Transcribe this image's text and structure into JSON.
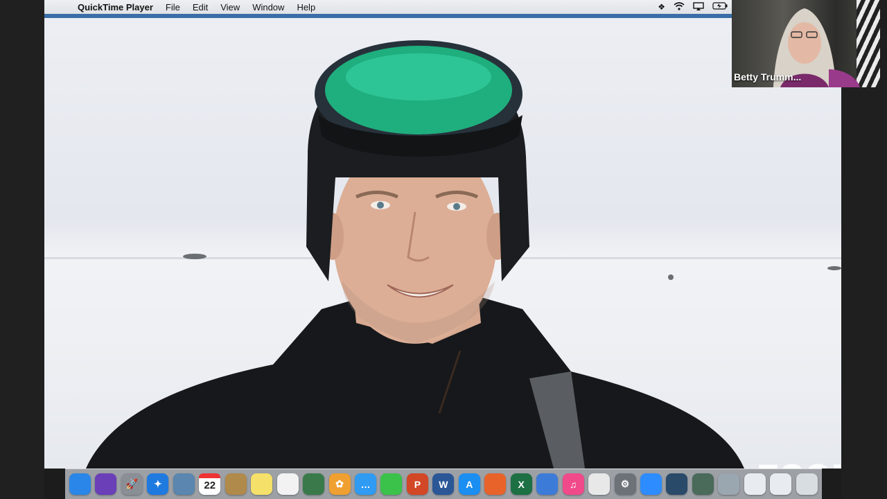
{
  "menubar": {
    "app_name": "QuickTime Player",
    "menus": [
      "File",
      "Edit",
      "View",
      "Window",
      "Help"
    ]
  },
  "thumbnail": {
    "participant_name": "Betty Trumm..."
  },
  "watermark": "zoom",
  "dock": {
    "calendar_day": "22",
    "icons": [
      {
        "name": "finder-icon",
        "color": "#2a86e8",
        "glyph": ""
      },
      {
        "name": "siri-icon",
        "color": "#6a3fb8",
        "glyph": ""
      },
      {
        "name": "launchpad-icon",
        "color": "#8a8f96",
        "glyph": "🚀"
      },
      {
        "name": "safari-icon",
        "color": "#1f7ae0",
        "glyph": "✦"
      },
      {
        "name": "preview-icon",
        "color": "#5a86b0",
        "glyph": ""
      },
      {
        "name": "calendar-icon",
        "color": "#ffffff",
        "glyph": ""
      },
      {
        "name": "contacts-icon",
        "color": "#b08a4a",
        "glyph": ""
      },
      {
        "name": "notes-icon",
        "color": "#f5e06a",
        "glyph": ""
      },
      {
        "name": "reminders-icon",
        "color": "#f2f2f2",
        "glyph": ""
      },
      {
        "name": "photo-booth-icon",
        "color": "#3a7a4a",
        "glyph": ""
      },
      {
        "name": "photos-icon",
        "color": "#f0a030",
        "glyph": "✿"
      },
      {
        "name": "messages-icon",
        "color": "#2f9bf2",
        "glyph": "…"
      },
      {
        "name": "facetime-icon",
        "color": "#3bc24a",
        "glyph": ""
      },
      {
        "name": "powerpoint-icon",
        "color": "#d24726",
        "glyph": "P"
      },
      {
        "name": "word-icon",
        "color": "#2b5797",
        "glyph": "W"
      },
      {
        "name": "app-store-icon",
        "color": "#1b8ef2",
        "glyph": "A"
      },
      {
        "name": "firefox-icon",
        "color": "#e8632a",
        "glyph": ""
      },
      {
        "name": "excel-icon",
        "color": "#1d7044",
        "glyph": "X"
      },
      {
        "name": "keynote-icon",
        "color": "#3d7bd9",
        "glyph": ""
      },
      {
        "name": "itunes-icon",
        "color": "#f04a8a",
        "glyph": "♫"
      },
      {
        "name": "chrome-icon",
        "color": "#e8e8e8",
        "glyph": ""
      },
      {
        "name": "system-preferences-icon",
        "color": "#6d7278",
        "glyph": "⚙"
      },
      {
        "name": "zoom-icon",
        "color": "#2d8cff",
        "glyph": ""
      },
      {
        "name": "quicktime-icon",
        "color": "#2a4a6a",
        "glyph": ""
      },
      {
        "name": "screen-utility-icon",
        "color": "#4a6a5a",
        "glyph": ""
      },
      {
        "name": "screenshot-icon",
        "color": "#9aa6b0",
        "glyph": ""
      },
      {
        "name": "file-stack-icon",
        "color": "#e8ecf0",
        "glyph": ""
      },
      {
        "name": "file-stack-icon-2",
        "color": "#e8ecf0",
        "glyph": ""
      },
      {
        "name": "trash-icon",
        "color": "#d8dde2",
        "glyph": ""
      }
    ]
  }
}
